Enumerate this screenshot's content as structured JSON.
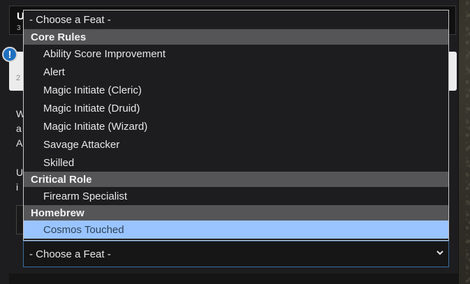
{
  "header": {
    "title": "U",
    "subtitle": "3"
  },
  "alert": {
    "icon": "exclamation-icon",
    "glyph": "!",
    "text": "2"
  },
  "body": {
    "paragraph1_lines": [
      "W",
      "a",
      "A"
    ],
    "paragraph2_lines": [
      "U",
      "i"
    ]
  },
  "feat_select": {
    "selected_label": "- Choose a Feat -",
    "chevron_icon": "chevron-down-icon"
  },
  "dropdown": {
    "placeholder": "- Choose a Feat -",
    "groups": [
      {
        "label": "Core Rules",
        "options": [
          "Ability Score Improvement",
          "Alert",
          "Magic Initiate (Cleric)",
          "Magic Initiate (Druid)",
          "Magic Initiate (Wizard)",
          "Savage Attacker",
          "Skilled"
        ]
      },
      {
        "label": "Critical Role",
        "options": [
          "Firearm Specialist"
        ]
      },
      {
        "label": "Homebrew",
        "options": [
          "Cosmos Touched"
        ]
      }
    ],
    "highlighted_option": "Cosmos Touched"
  },
  "colors": {
    "highlight": "#99c4ff",
    "group_header": "#555557",
    "panel": "#1d1d1f",
    "select_border": "#3d6ea0",
    "alert_icon": "#1f6fbf"
  }
}
